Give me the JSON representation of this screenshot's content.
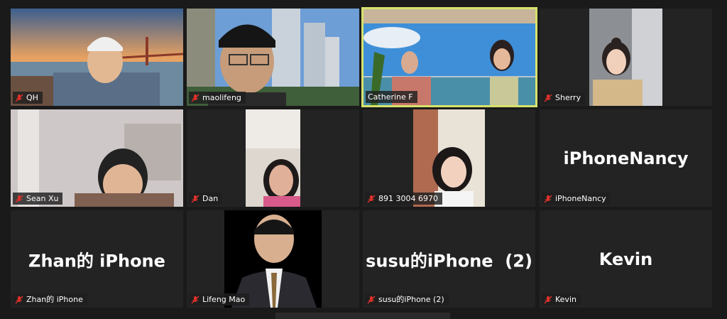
{
  "participants": [
    {
      "name": "QH",
      "label": "QH",
      "type": "video",
      "muted": true
    },
    {
      "name": "maolifeng",
      "label": "maolifeng",
      "type": "video",
      "muted": true
    },
    {
      "name": "Catherine F",
      "label": "Catherine F",
      "type": "video",
      "muted": false,
      "active_speaker": true
    },
    {
      "name": "Sherry",
      "label": "Sherry",
      "type": "video",
      "muted": true
    },
    {
      "name": "Sean Xu",
      "label": "Sean Xu",
      "type": "video",
      "muted": true
    },
    {
      "name": "Dan",
      "label": "Dan",
      "type": "video",
      "muted": true
    },
    {
      "name": "891 3004 6970",
      "label": "891 3004 6970",
      "type": "video",
      "muted": true
    },
    {
      "name": "iPhoneNancy",
      "label": "iPhoneNancy",
      "display_name": "iPhoneNancy",
      "type": "name_only",
      "muted": true
    },
    {
      "name": "Zhan的 iPhone",
      "label": "Zhan的 iPhone",
      "display_name": "Zhan的 iPhone",
      "type": "name_only",
      "muted": true
    },
    {
      "name": "Lifeng Mao",
      "label": "Lifeng Mao",
      "type": "photo",
      "muted": true
    },
    {
      "name": "susu的iPhone (2)",
      "label": "susu的iPhone (2)",
      "display_name": "susu的iPhone  (2)",
      "type": "name_only",
      "muted": true
    },
    {
      "name": "Kevin",
      "label": "Kevin",
      "display_name": "Kevin",
      "type": "name_only",
      "muted": true
    }
  ],
  "colors": {
    "background": "#1a1a1a",
    "tile": "#232323",
    "active_border": "#d7e26b",
    "muted_icon": "#e0312b"
  },
  "icons": {
    "muted": "mic-muted-icon"
  }
}
